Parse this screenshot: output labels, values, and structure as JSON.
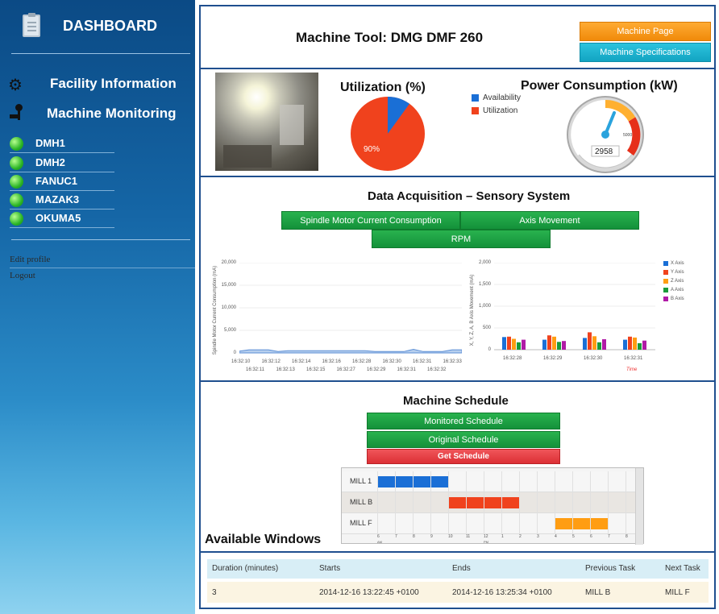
{
  "sidebar": {
    "title": "DASHBOARD",
    "facility": "Facility Information",
    "monitoring": "Machine Monitoring",
    "machines": [
      "DMH1",
      "DMH2",
      "FANUC1",
      "MAZAK3",
      "OKUMA5"
    ],
    "edit": "Edit profile",
    "logout": "Logout"
  },
  "header": {
    "title": "Machine Tool: DMG DMF 260",
    "machine_page": "Machine Page",
    "machine_specs": "Machine Specifications"
  },
  "utilization": {
    "title": "Utilization (%)",
    "legend": [
      "Availability",
      "Utilization"
    ],
    "label": "90%",
    "value_pct": 90,
    "colors": [
      "#1a6fd6",
      "#f0421d"
    ]
  },
  "power": {
    "title": "Power Consumption (kW)",
    "value": "2958",
    "scale_label": "5000"
  },
  "acquisition": {
    "title": "Data Acquisition – Sensory System",
    "buttons": [
      "Spindle Motor Current Consumption",
      "Axis Movement",
      "RPM"
    ]
  },
  "chart_data": [
    {
      "type": "line",
      "ylabel": "Spindle Motor Current Consumption (mA)",
      "ylim": [
        0,
        20000
      ],
      "yticks": [
        "20,000",
        "15,000",
        "10,000",
        "5,000",
        "0"
      ],
      "x_top": [
        "16:32:10",
        "16:32:12",
        "16:32:14",
        "16:32:16",
        "16:32:28",
        "16:32:30",
        "16:32:31",
        "16:32:33"
      ],
      "x_bottom": [
        "16:32:11",
        "16:32:13",
        "16:32:15",
        "16:32:27",
        "16:32:29",
        "16:32:31",
        "16:32:32"
      ],
      "values": [
        400,
        700,
        700,
        700,
        300,
        500,
        500,
        500,
        500,
        500,
        500,
        500,
        500,
        500,
        300,
        300,
        300,
        300,
        800,
        300,
        300,
        300,
        700,
        700
      ]
    },
    {
      "type": "bar",
      "ylabel": "X, Y, Z, A, B Axis Movement (mA)",
      "xlabel": "Time",
      "ylim": [
        0,
        2000
      ],
      "yticks": [
        "2,000",
        "1,500",
        "1,000",
        "500",
        "0"
      ],
      "categories": [
        "16:32:28",
        "16:32:29",
        "16:32:30",
        "16:32:31"
      ],
      "series": [
        {
          "name": "X Axis",
          "color": "#1a6fd6",
          "values": [
            290,
            230,
            270,
            230
          ]
        },
        {
          "name": "Y Axis",
          "color": "#f0421d",
          "values": [
            300,
            330,
            400,
            300
          ]
        },
        {
          "name": "Z Axis",
          "color": "#ff9d12",
          "values": [
            250,
            300,
            310,
            280
          ]
        },
        {
          "name": "A Axis",
          "color": "#1a9b3a",
          "values": [
            170,
            180,
            170,
            150
          ]
        },
        {
          "name": "B Axis",
          "color": "#b01aa6",
          "values": [
            230,
            200,
            240,
            210
          ]
        }
      ]
    }
  ],
  "schedule": {
    "title": "Machine Schedule",
    "monitored": "Monitored Schedule",
    "original": "Original Schedule",
    "get": "Get Schedule",
    "rows": [
      "MILL 1",
      "MILL B",
      "MILL F"
    ],
    "hours": [
      "6",
      "7",
      "8",
      "9",
      "10",
      "11",
      "12",
      "1",
      "2",
      "3",
      "4",
      "5",
      "6",
      "7",
      "8"
    ],
    "am": "AM",
    "pm": "PM",
    "tasks": [
      {
        "row": 0,
        "start": 6,
        "end": 10,
        "color": "#1a6fd6"
      },
      {
        "row": 1,
        "start": 10,
        "end": 14,
        "color": "#f0421d"
      },
      {
        "row": 2,
        "start": 16,
        "end": 19,
        "color": "#ff9d12"
      }
    ]
  },
  "windows": {
    "title": "Available Windows",
    "headers": [
      "Duration (minutes)",
      "Starts",
      "Ends",
      "Previous Task",
      "Next Task"
    ],
    "row": [
      "3",
      "2014-12-16 13:22:45 +0100",
      "2014-12-16 13:25:34 +0100",
      "MILL B",
      "MILL F"
    ]
  }
}
